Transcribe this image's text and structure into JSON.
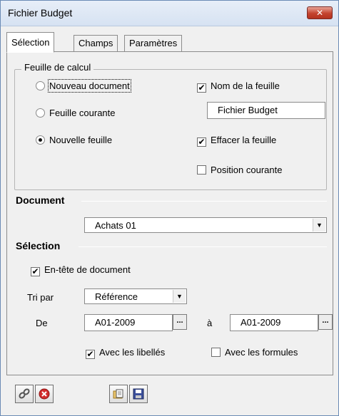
{
  "window": {
    "title": "Fichier Budget",
    "close_label": "x"
  },
  "tabs": [
    {
      "label": "Sélection",
      "active": true
    },
    {
      "label": "Champs",
      "active": false
    },
    {
      "label": "Paramètres",
      "active": false
    }
  ],
  "sheet_group": {
    "legend": "Feuille de calcul",
    "options": [
      {
        "label": "Nouveau document",
        "selected": false
      },
      {
        "label": "Feuille courante",
        "selected": false
      },
      {
        "label": "Nouvelle feuille",
        "selected": true
      }
    ],
    "sheet_name_check": {
      "label": "Nom de la feuille",
      "checked": true
    },
    "sheet_name_value": "Fichier Budget",
    "clear_sheet_check": {
      "label": "Effacer la feuille",
      "checked": true
    },
    "current_position_check": {
      "label": "Position courante",
      "checked": false
    }
  },
  "document": {
    "label": "Document",
    "selected": "Achats 01"
  },
  "selection": {
    "label": "Sélection",
    "header_check": {
      "label": "En-tête de document",
      "checked": true
    },
    "sort_label": "Tri par",
    "sort_value": "Référence",
    "from_label": "De",
    "from_value": "A01-2009",
    "to_label": "à",
    "to_value": "A01-2009",
    "browse_label": "...",
    "labels_check": {
      "label": "Avec les libellés",
      "checked": true
    },
    "formulas_check": {
      "label": "Avec les formules",
      "checked": false
    }
  },
  "icons": {
    "check_mark": "✔",
    "dropdown": "▼"
  }
}
